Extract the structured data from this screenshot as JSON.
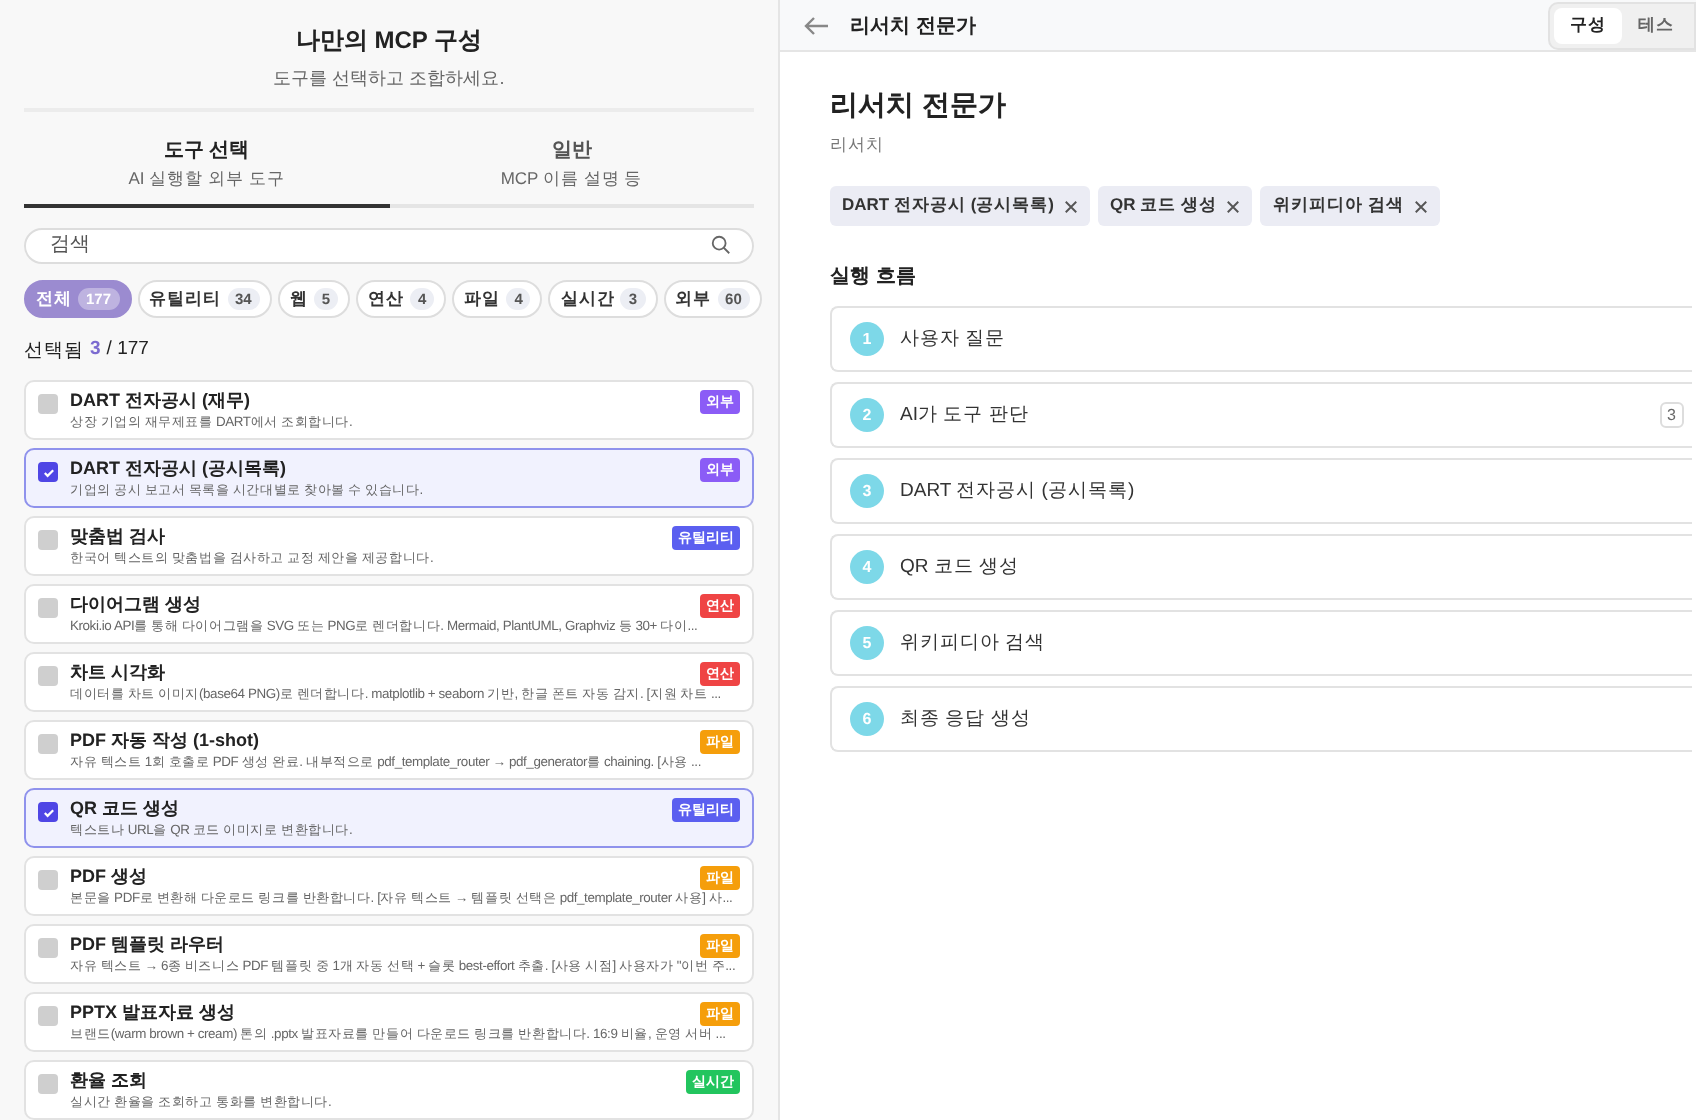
{
  "builder": {
    "title": "나만의 MCP 구성",
    "subtitle": "도구를 선택하고 조합하세요.",
    "tabs": [
      {
        "label": "도구 선택",
        "sub": "AI 실행할 외부 도구",
        "selected": true
      },
      {
        "label": "일반",
        "sub": "MCP 이름 설명 등",
        "selected": false
      }
    ],
    "search": {
      "placeholder": "검색"
    },
    "filters": [
      {
        "label": "전체",
        "count": "177",
        "selected": true
      },
      {
        "label": "유틸리티",
        "count": "34",
        "selected": false
      },
      {
        "label": "웹",
        "count": "5",
        "selected": false
      },
      {
        "label": "연산",
        "count": "4",
        "selected": false
      },
      {
        "label": "파일",
        "count": "4",
        "selected": false
      },
      {
        "label": "실시간",
        "count": "3",
        "selected": false
      },
      {
        "label": "외부",
        "count": "60",
        "selected": false
      }
    ],
    "selected_label": "선택됨",
    "selected_count": "3",
    "total": "/ 177",
    "tools": [
      {
        "name": "DART 전자공시 (재무)",
        "desc": "상장 기업의 재무제표를 DART에서 조회합니다.",
        "tag": "외부",
        "color": "#8b5cf6",
        "checked": false
      },
      {
        "name": "DART 전자공시 (공시목록)",
        "desc": "기업의 공시 보고서 목록을 시간대별로 찾아볼 수 있습니다.",
        "tag": "외부",
        "color": "#8b5cf6",
        "checked": true
      },
      {
        "name": "맞춤법 검사",
        "desc": "한국어 텍스트의 맞춤법을 검사하고 교정 제안을 제공합니다.",
        "tag": "유틸리티",
        "color": "#5b5ff0",
        "checked": false
      },
      {
        "name": "다이어그램 생성",
        "desc": "Kroki.io API를 통해 다이어그램을 SVG 또는 PNG로 렌더합니다. Mermaid, PlantUML, Graphviz 등 30+ 다이...",
        "tag": "연산",
        "color": "#ef4444",
        "checked": false
      },
      {
        "name": "차트 시각화",
        "desc": "데이터를 차트 이미지(base64 PNG)로 렌더합니다. matplotlib + seaborn 기반, 한글 폰트 자동 감지. [지원 차트 ...",
        "tag": "연산",
        "color": "#ef4444",
        "checked": false
      },
      {
        "name": "PDF 자동 작성 (1-shot)",
        "desc": "자유 텍스트 1회 호출로 PDF 생성 완료. 내부적으로 pdf_template_router → pdf_generator를 chaining. [사용 ...",
        "tag": "파일",
        "color": "#f59e0b",
        "checked": false
      },
      {
        "name": "QR 코드 생성",
        "desc": "텍스트나 URL을 QR 코드 이미지로 변환합니다.",
        "tag": "유틸리티",
        "color": "#5b5ff0",
        "checked": true
      },
      {
        "name": "PDF 생성",
        "desc": "본문을 PDF로 변환해 다운로드 링크를 반환합니다. [자유 텍스트 → 템플릿 선택은 pdf_template_router 사용] 사...",
        "tag": "파일",
        "color": "#f59e0b",
        "checked": false
      },
      {
        "name": "PDF 템플릿 라우터",
        "desc": "자유 텍스트 → 6종 비즈니스 PDF 템플릿 중 1개 자동 선택 + 슬롯 best-effort 추출. [사용 시점] 사용자가 \"이번 주...",
        "tag": "파일",
        "color": "#f59e0b",
        "checked": false
      },
      {
        "name": "PPTX 발표자료 생성",
        "desc": "브랜드(warm brown + cream) 톤의 .pptx 발표자료를 만들어 다운로드 링크를 반환합니다. 16:9 비율, 운영 서버 ...",
        "tag": "파일",
        "color": "#f59e0b",
        "checked": false
      },
      {
        "name": "환율 조회",
        "desc": "실시간 환율을 조회하고 통화를 변환합니다.",
        "tag": "실시간",
        "color": "#22c55e",
        "checked": false
      }
    ]
  },
  "header": {
    "title": "리서치 전문가",
    "tabs": [
      {
        "label": "구성",
        "selected": true
      },
      {
        "label": "테스",
        "selected": false
      }
    ]
  },
  "agent": {
    "name": "리서치 전문가",
    "category": "리서치",
    "chips": [
      "DART 전자공시 (공시목록)",
      "QR 코드 생성",
      "위키피디아 검색"
    ],
    "flow_title": "실행 흐름",
    "steps": [
      {
        "num": "1",
        "label": "사용자 질문"
      },
      {
        "num": "2",
        "label": "AI가 도구 판단",
        "badge": "3"
      },
      {
        "num": "3",
        "label": "DART 전자공시 (공시목록)"
      },
      {
        "num": "4",
        "label": "QR 코드 생성"
      },
      {
        "num": "5",
        "label": "위키피디아 검색"
      },
      {
        "num": "6",
        "label": "최종 응답 생성"
      }
    ]
  }
}
